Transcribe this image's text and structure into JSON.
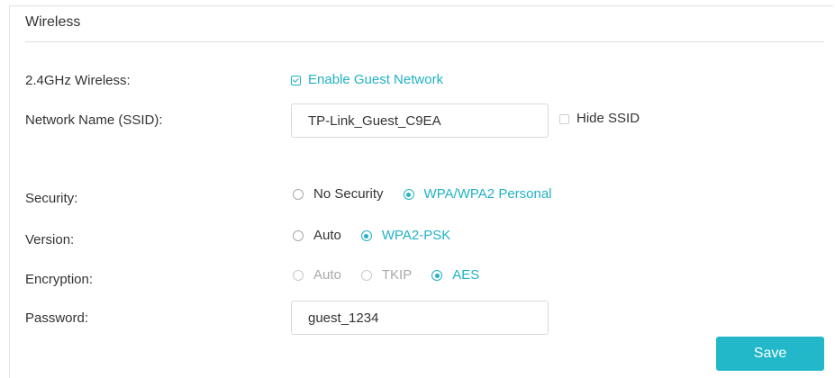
{
  "section": {
    "title": "Wireless"
  },
  "wireless_24": {
    "label": "2.4GHz Wireless:",
    "enable_guest_label": "Enable Guest Network",
    "enable_guest_checked": true
  },
  "ssid": {
    "label": "Network Name (SSID):",
    "value": "TP-Link_Guest_C9EA",
    "hide_label": "Hide SSID",
    "hide_checked": false
  },
  "security": {
    "label": "Security:",
    "options": [
      "No Security",
      "WPA/WPA2 Personal"
    ],
    "selected": "WPA/WPA2 Personal"
  },
  "version": {
    "label": "Version:",
    "options": [
      "Auto",
      "WPA2-PSK"
    ],
    "selected": "WPA2-PSK"
  },
  "encryption": {
    "label": "Encryption:",
    "options": [
      "Auto",
      "TKIP",
      "AES"
    ],
    "selected": "AES"
  },
  "password": {
    "label": "Password:",
    "value": "guest_1234"
  },
  "actions": {
    "save_label": "Save"
  },
  "colors": {
    "accent": "#22b7c9",
    "text": "#333333",
    "disabled": "#a9a9a9"
  }
}
